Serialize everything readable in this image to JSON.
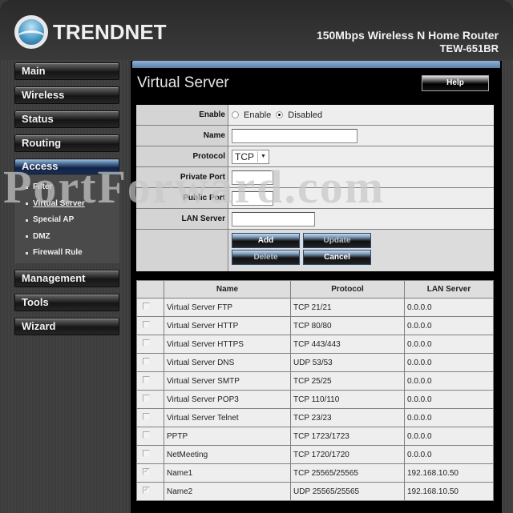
{
  "header": {
    "brand": "TRENDnet",
    "product_line": "150Mbps Wireless N Home Router",
    "model": "TEW-651BR"
  },
  "sidebar": {
    "items": [
      {
        "label": "Main"
      },
      {
        "label": "Wireless"
      },
      {
        "label": "Status"
      },
      {
        "label": "Routing"
      },
      {
        "label": "Access",
        "active": true
      },
      {
        "label": "Management"
      },
      {
        "label": "Tools"
      },
      {
        "label": "Wizard"
      }
    ],
    "access_subitems": [
      {
        "label": "Filter"
      },
      {
        "label": "Virtual Server",
        "current": true
      },
      {
        "label": "Special AP"
      },
      {
        "label": "DMZ"
      },
      {
        "label": "Firewall Rule"
      }
    ]
  },
  "page": {
    "title": "Virtual Server",
    "help_label": "Help"
  },
  "form": {
    "enable_label": "Enable",
    "enable_option": "Enable",
    "disabled_option": "Disabled",
    "enable_selected": "Disabled",
    "name_label": "Name",
    "name_value": "",
    "protocol_label": "Protocol",
    "protocol_value": "TCP",
    "private_port_label": "Private Port",
    "private_port_value": "",
    "public_port_label": "Public Port",
    "public_port_value": "",
    "lan_server_label": "LAN Server",
    "lan_server_value": "",
    "buttons": {
      "add": "Add",
      "update": "Update",
      "delete": "Delete",
      "cancel": "Cancel"
    }
  },
  "table": {
    "headers": [
      "",
      "Name",
      "Protocol",
      "LAN Server"
    ],
    "rows": [
      {
        "checked": false,
        "name": "Virtual Server FTP",
        "protocol": "TCP 21/21",
        "lan_server": "0.0.0.0"
      },
      {
        "checked": false,
        "name": "Virtual Server HTTP",
        "protocol": "TCP 80/80",
        "lan_server": "0.0.0.0"
      },
      {
        "checked": false,
        "name": "Virtual Server HTTPS",
        "protocol": "TCP 443/443",
        "lan_server": "0.0.0.0"
      },
      {
        "checked": false,
        "name": "Virtual Server DNS",
        "protocol": "UDP 53/53",
        "lan_server": "0.0.0.0"
      },
      {
        "checked": false,
        "name": "Virtual Server SMTP",
        "protocol": "TCP 25/25",
        "lan_server": "0.0.0.0"
      },
      {
        "checked": false,
        "name": "Virtual Server POP3",
        "protocol": "TCP 110/110",
        "lan_server": "0.0.0.0"
      },
      {
        "checked": false,
        "name": "Virtual Server Telnet",
        "protocol": "TCP 23/23",
        "lan_server": "0.0.0.0"
      },
      {
        "checked": false,
        "name": "PPTP",
        "protocol": "TCP 1723/1723",
        "lan_server": "0.0.0.0"
      },
      {
        "checked": false,
        "name": "NetMeeting",
        "protocol": "TCP 1720/1720",
        "lan_server": "0.0.0.0"
      },
      {
        "checked": true,
        "name": "Name1",
        "protocol": "TCP 25565/25565",
        "lan_server": "192.168.10.50"
      },
      {
        "checked": true,
        "name": "Name2",
        "protocol": "UDP 25565/25565",
        "lan_server": "192.168.10.50"
      }
    ]
  },
  "watermark": "PortForward.com"
}
